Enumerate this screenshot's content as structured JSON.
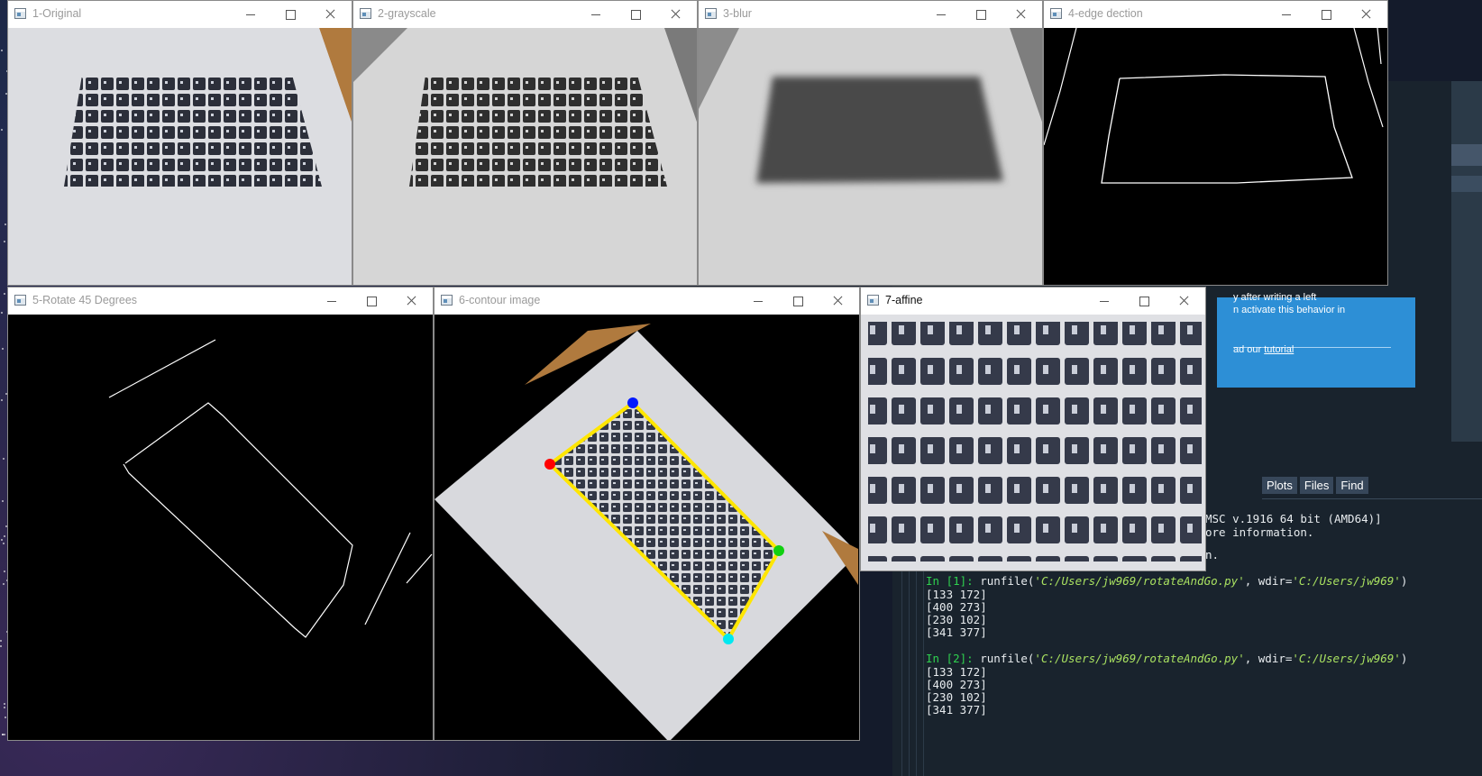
{
  "windows": [
    {
      "id": "original",
      "title": "1-Original"
    },
    {
      "id": "grayscale",
      "title": "2-grayscale"
    },
    {
      "id": "blur",
      "title": "3-blur"
    },
    {
      "id": "edge",
      "title": "4-edge dection"
    },
    {
      "id": "rotate",
      "title": "5-Rotate 45 Degrees"
    },
    {
      "id": "contour",
      "title": "6-contour image"
    },
    {
      "id": "affine",
      "title": "7-affine"
    }
  ],
  "tooltip": {
    "line1": "y after writing a left",
    "line2": "n activate this behavior in",
    "line3_prefix": "ad our ",
    "line3_link": "tutorial"
  },
  "ide_tabs": [
    "Plots",
    "Files",
    "Find"
  ],
  "console": {
    "header1": "MSC v.1916 64 bit (AMD64)]",
    "header2": "ore information.",
    "header3": "n.",
    "runs": [
      {
        "prompt": "In [1]:",
        "cmd_prefix": " runfile(",
        "arg1": "'C:/Users/jw969/rotateAndGo.py'",
        "mid": ", wdir=",
        "arg2": "'C:/Users/jw969'",
        "suffix": ")",
        "output": [
          "[133 172]",
          "[400 273]",
          "[230 102]",
          "[341 377]"
        ]
      },
      {
        "prompt": "In [2]:",
        "cmd_prefix": " runfile(",
        "arg1": "'C:/Users/jw969/rotateAndGo.py'",
        "mid": ", wdir=",
        "arg2": "'C:/Users/jw969'",
        "suffix": ")",
        "output": [
          "[133 172]",
          "[400 273]",
          "[230 102]",
          "[341 377]"
        ]
      }
    ]
  },
  "icons": {
    "window": "opencv-window-icon",
    "minimize": "minimize-icon",
    "maximize": "maximize-icon",
    "close": "close-icon"
  },
  "colors": {
    "contour": "#ffe600",
    "corner_red": "#ff0000",
    "corner_blue": "#0018ff",
    "corner_green": "#10d010",
    "corner_cyan": "#00e8f0",
    "tooltip_bg": "#2d8fd6"
  }
}
